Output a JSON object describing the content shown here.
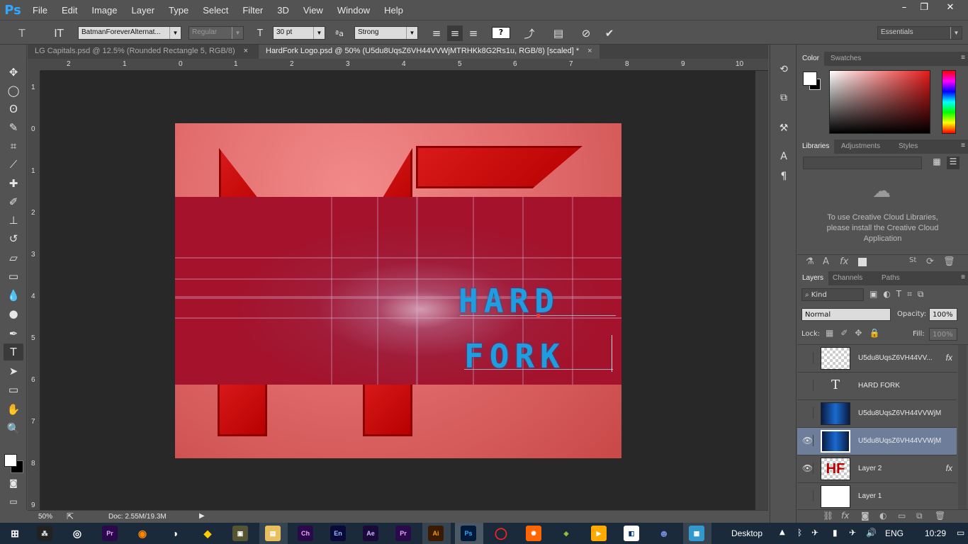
{
  "app": {
    "logo": "Ps"
  },
  "menu": [
    "File",
    "Edit",
    "Image",
    "Layer",
    "Type",
    "Select",
    "Filter",
    "3D",
    "View",
    "Window",
    "Help"
  ],
  "window_controls": {
    "minimize": "–",
    "restore": "❐",
    "close": "✕"
  },
  "options": {
    "font_family": "BatmanForeverAlternat...",
    "font_style": "Regular",
    "font_size": "30 pt",
    "antialias": "Strong",
    "workspace": "Essentials"
  },
  "tabs": [
    {
      "label": "LG Capitals.psd @ 12.5% (Rounded Rectangle 5, RGB/8)",
      "close": "×"
    },
    {
      "label": "HardFork Logo.psd @ 50% (U5du8UqsZ6VH44VVWjMTRHKk8G2Rs1u, RGB/8) [scaled] *",
      "close": "×"
    }
  ],
  "ruler_top": [
    "2",
    "1",
    "0",
    "1",
    "2",
    "3",
    "4",
    "5",
    "6",
    "7",
    "8",
    "9",
    "10"
  ],
  "ruler_left": [
    "1",
    "0",
    "1",
    "2",
    "3",
    "4",
    "5",
    "6",
    "7",
    "8",
    "9"
  ],
  "canvas": {
    "line1": "HARD",
    "line2": "FORK"
  },
  "status": {
    "zoom": "50%",
    "doc": "Doc: 2.55M/19.3M"
  },
  "color_panel": {
    "tabs": [
      "Color",
      "Swatches"
    ]
  },
  "libraries_panel": {
    "tabs": [
      "Libraries",
      "Adjustments",
      "Styles"
    ],
    "message": "To use Creative Cloud Libraries, please install the Creative Cloud Application"
  },
  "layers_panel": {
    "tabs": [
      "Layers",
      "Channels",
      "Paths"
    ],
    "filter": "Kind",
    "blend_mode": "Normal",
    "opacity_label": "Opacity:",
    "opacity": "100%",
    "lock_label": "Lock:",
    "fill_label": "Fill:",
    "fill": "100%",
    "layers": [
      {
        "name": "U5du8UqsZ6VH44VV...",
        "visible": false,
        "fx": "fx"
      },
      {
        "name": "HARD FORK",
        "visible": false
      },
      {
        "name": "U5du8UqsZ6VH44VVWjM...",
        "visible": false
      },
      {
        "name": "U5du8UqsZ6VH44VVWjM...",
        "visible": true
      },
      {
        "name": "Layer 2",
        "visible": true,
        "fx": "fx"
      },
      {
        "name": "Layer 1",
        "visible": false
      }
    ]
  },
  "taskbar": {
    "apps": [
      "Pr",
      "Ch",
      "En",
      "Ae",
      "Pr",
      "Ai",
      "Ps"
    ],
    "desktop_label": "Desktop",
    "language": "ENG",
    "time": "10:29"
  }
}
